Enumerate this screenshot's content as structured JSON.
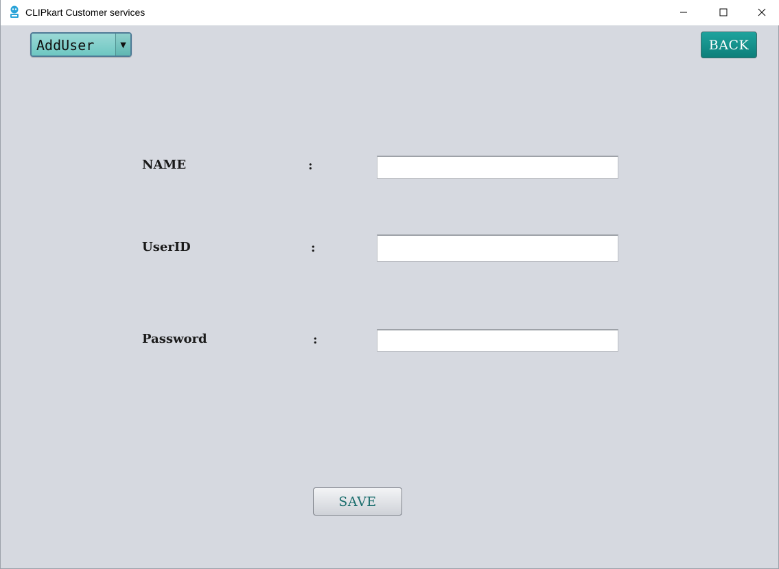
{
  "window": {
    "title": "CLIPkart Customer services",
    "icon": "robot-icon",
    "controls": {
      "minimize_icon": "minimize-icon",
      "maximize_icon": "maximize-icon",
      "close_icon": "close-icon"
    }
  },
  "toolbar": {
    "mode_select": {
      "selected": "AddUser",
      "arrow_icon": "chevron-down-icon"
    },
    "back_label": "BACK"
  },
  "form": {
    "fields": [
      {
        "label": "NAME",
        "colon": ":",
        "value": ""
      },
      {
        "label": "UserID",
        "colon": ":",
        "value": ""
      },
      {
        "label": "Password",
        "colon": ":",
        "value": ""
      }
    ],
    "save_label": "SAVE"
  },
  "colors": {
    "background": "#d6d9e0",
    "accent": "#0c7f7a",
    "combo_fill": "#7ecbc7",
    "save_text": "#1c6e6e"
  }
}
